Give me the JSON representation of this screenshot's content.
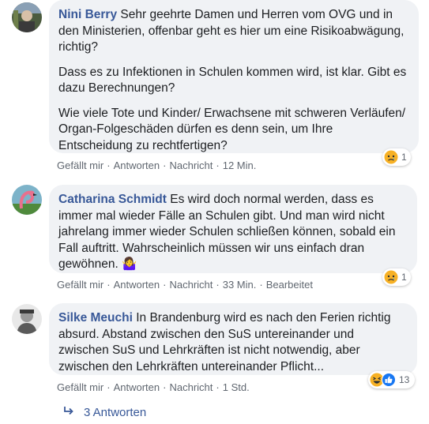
{
  "comments": [
    {
      "author": "Nini Berry",
      "paragraphs": [
        "Sehr geehrte Damen und Herren vom OVG und in den Ministerien, offenbar geht es hier um eine Risikoabwägung, richtig?",
        "Dass es zu Infektionen in Schulen kommen wird, ist klar. Gibt es dazu Berechnungen?",
        "Wie viele Tote und Kinder/ Erwachsene mit schweren Verläufen/ Organ-Folgeschäden dürfen es denn sein, um Ihre Entscheidung zu rechtfertigen?"
      ],
      "like": "Gefällt mir",
      "reply": "Antworten",
      "message": "Nachricht",
      "time": "12 Min.",
      "reaction_count": "1"
    },
    {
      "author": "Catharina Schmidt",
      "paragraphs": [
        "Es wird doch normal werden, dass es immer mal wieder Fälle an Schulen gibt. Und man wird nicht jahrelang immer wieder Schulen schließen können, sobald ein Fall auftritt. Wahrscheinlich müssen wir uns einfach dran gewöhnen. 🤷‍♀️"
      ],
      "like": "Gefällt mir",
      "reply": "Antworten",
      "message": "Nachricht",
      "time": "33 Min.",
      "edited": "Bearbeitet",
      "reaction_count": "1"
    },
    {
      "author": "Silke Meuchi",
      "paragraphs": [
        "In Brandenburg wird es nach den Ferien richtig absurd. Abstand zwischen den SuS untereinander und zwischen SuS und Lehrkräften ist nicht notwendig, aber zwischen den Lehrkräften untereinander Pflicht..."
      ],
      "like": "Gefällt mir",
      "reply": "Antworten",
      "message": "Nachricht",
      "time": "1 Std.",
      "reaction_count": "13"
    }
  ],
  "replies_label": "3 Antworten",
  "colors": {
    "author": "#385898",
    "bubble": "#f0f2f5",
    "meta": "#606770"
  }
}
